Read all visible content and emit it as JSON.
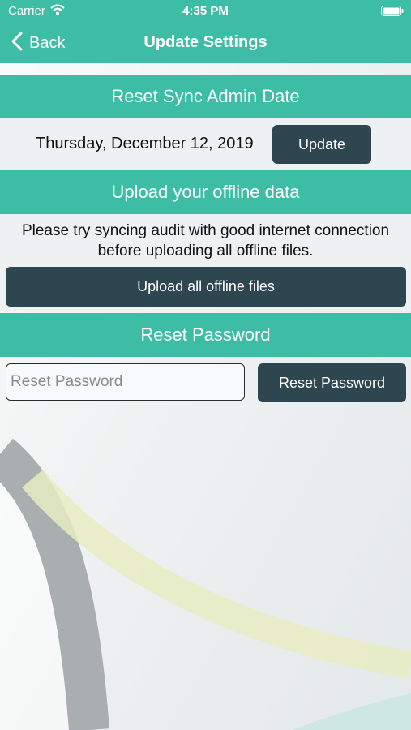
{
  "status_bar": {
    "carrier": "Carrier",
    "time": "4:35 PM",
    "wifi_icon": "wifi-icon",
    "battery_icon": "battery-icon"
  },
  "nav": {
    "back_label": "Back",
    "title": "Update Settings"
  },
  "sections": {
    "sync": {
      "header": "Reset Sync Admin Date",
      "date_value": "Thursday, December 12, 2019",
      "update_button": "Update"
    },
    "upload": {
      "header": "Upload your offline data",
      "note": "Please try syncing audit with good internet connection before uploading all offline files.",
      "upload_button": "Upload all offline files"
    },
    "password": {
      "header": "Reset Password",
      "input_placeholder": "Reset Password",
      "input_value": "",
      "reset_button": "Reset Password"
    }
  },
  "colors": {
    "accent": "#3dbda6",
    "button_dark": "#2e4650",
    "row_background": "#eef1f2"
  }
}
